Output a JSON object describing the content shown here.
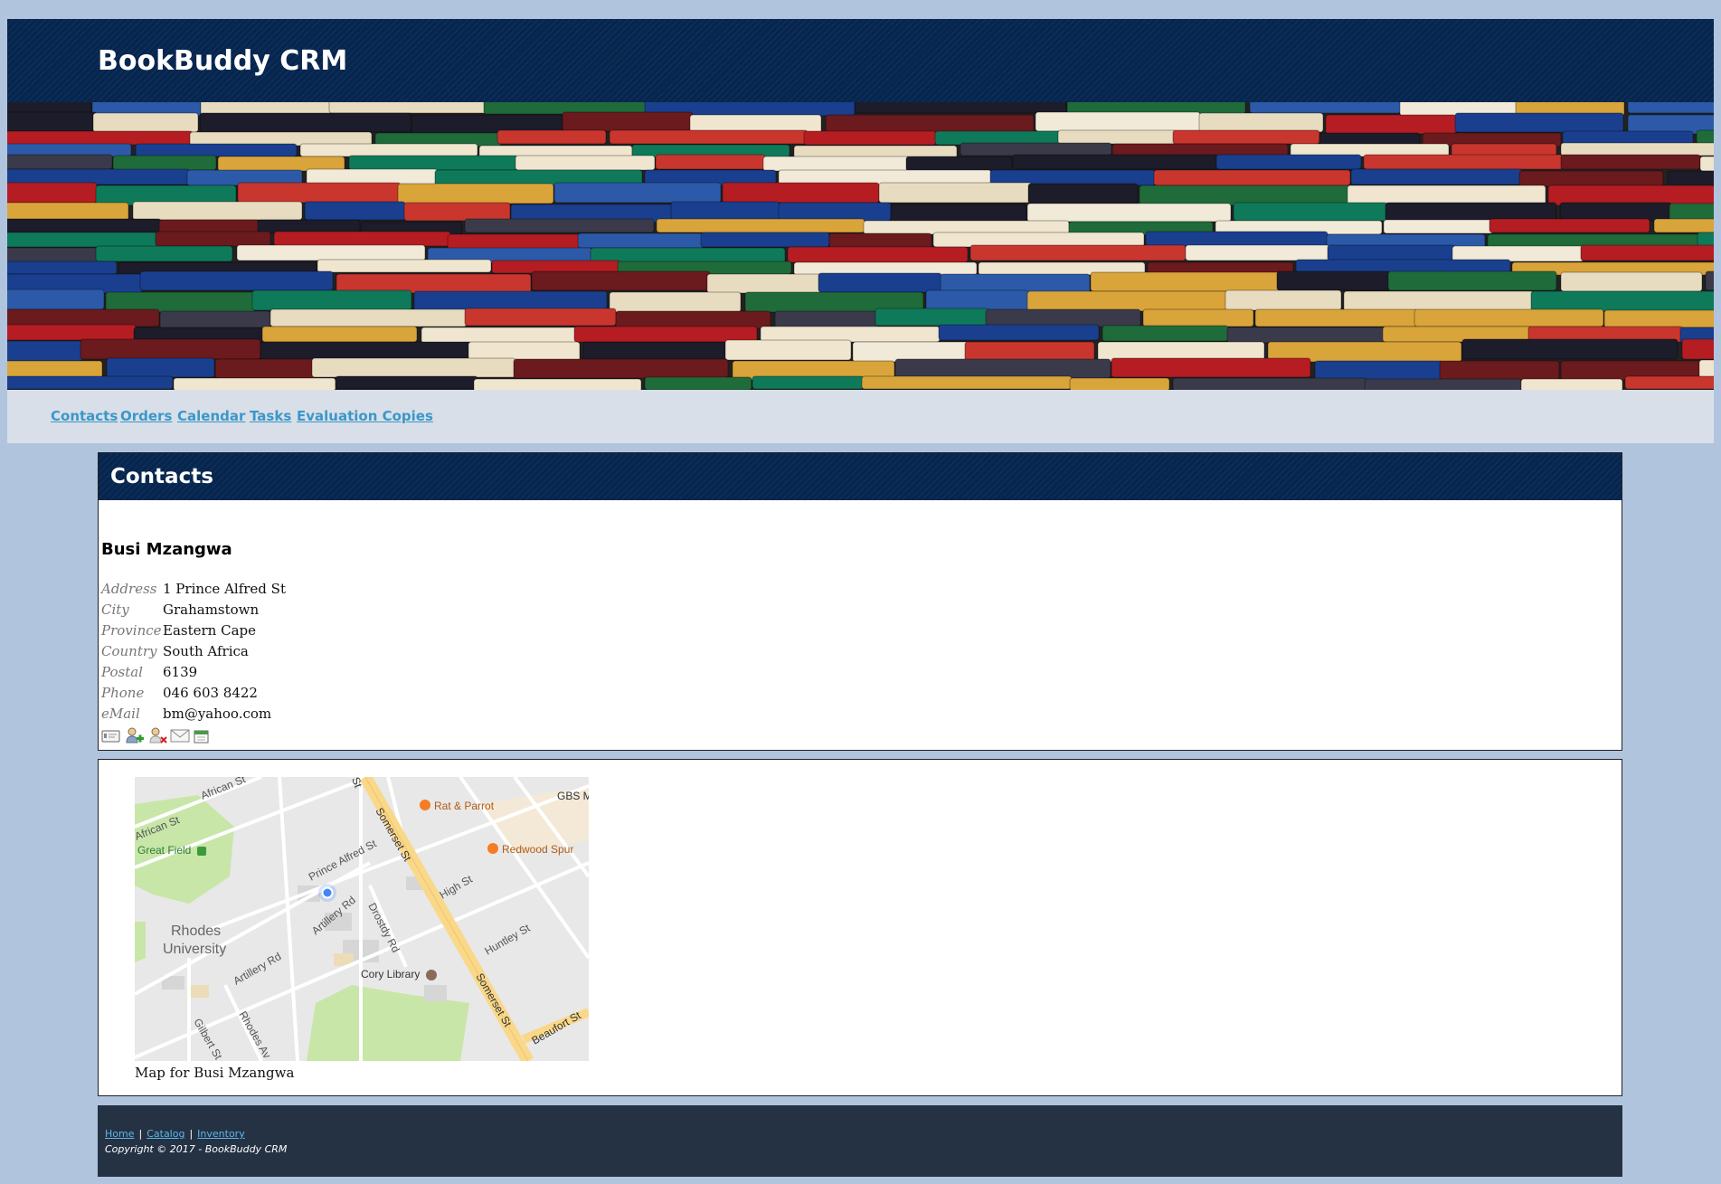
{
  "site": {
    "title": "BookBuddy CRM"
  },
  "nav": {
    "items": [
      {
        "label": "Contacts"
      },
      {
        "label": "Orders"
      },
      {
        "label": "Calendar"
      },
      {
        "label": "Tasks"
      },
      {
        "label": "Evaluation Copies"
      }
    ]
  },
  "contacts": {
    "heading": "Contacts",
    "name": "Busi Mzangwa",
    "fields": [
      {
        "label": "Address",
        "value": "1 Prince Alfred St"
      },
      {
        "label": "City",
        "value": "Grahamstown"
      },
      {
        "label": "Province",
        "value": "Eastern Cape"
      },
      {
        "label": "Country",
        "value": "South Africa"
      },
      {
        "label": "Postal",
        "value": "6139"
      },
      {
        "label": "Phone",
        "value": "046 603 8422"
      },
      {
        "label": "eMail",
        "value": "bm@yahoo.com"
      }
    ],
    "actions": [
      "id-card-icon",
      "add-user-icon",
      "remove-user-icon",
      "email-icon",
      "calendar-icon"
    ]
  },
  "map": {
    "caption": "Map for Busi Mzangwa",
    "labels": {
      "african_st_1": "African St",
      "african_st_2": "African St",
      "great_field": "Great Field",
      "prince_alfred": "Prince Alfred St",
      "somerset_1": "Somerset St",
      "somerset_2": "Somerset St",
      "rat_parrot": "Rat & Parrot",
      "gbs": "GBS M",
      "redwood": "Redwood Spur",
      "high_st": "High St",
      "artillery_1": "Artillery Rd",
      "artillery_2": "Artillery Rd",
      "drostdy": "Drostdy Rd",
      "rhodes_1": "Rhodes",
      "rhodes_2": "University",
      "huntley": "Huntley St",
      "cory": "Cory Library",
      "beaufort": "Beaufort St",
      "gilbert": "Gilbert St",
      "rhodes_av": "Rhodes Av",
      "st_fragment": "St"
    }
  },
  "footer": {
    "links": [
      {
        "label": "Home"
      },
      {
        "label": "Catalog"
      },
      {
        "label": "Inventory"
      }
    ],
    "separator": "|",
    "copyright": "Copyright © 2017 - BookBuddy CRM"
  },
  "colors": {
    "page_bg": "#b0c4de",
    "header_bg": "#06264f",
    "nav_bg": "#d8dfe8",
    "link": "#3c97c8",
    "footer_bg": "#243244",
    "map_road_major": "#f9d88a",
    "map_park": "#c8e6a8"
  }
}
